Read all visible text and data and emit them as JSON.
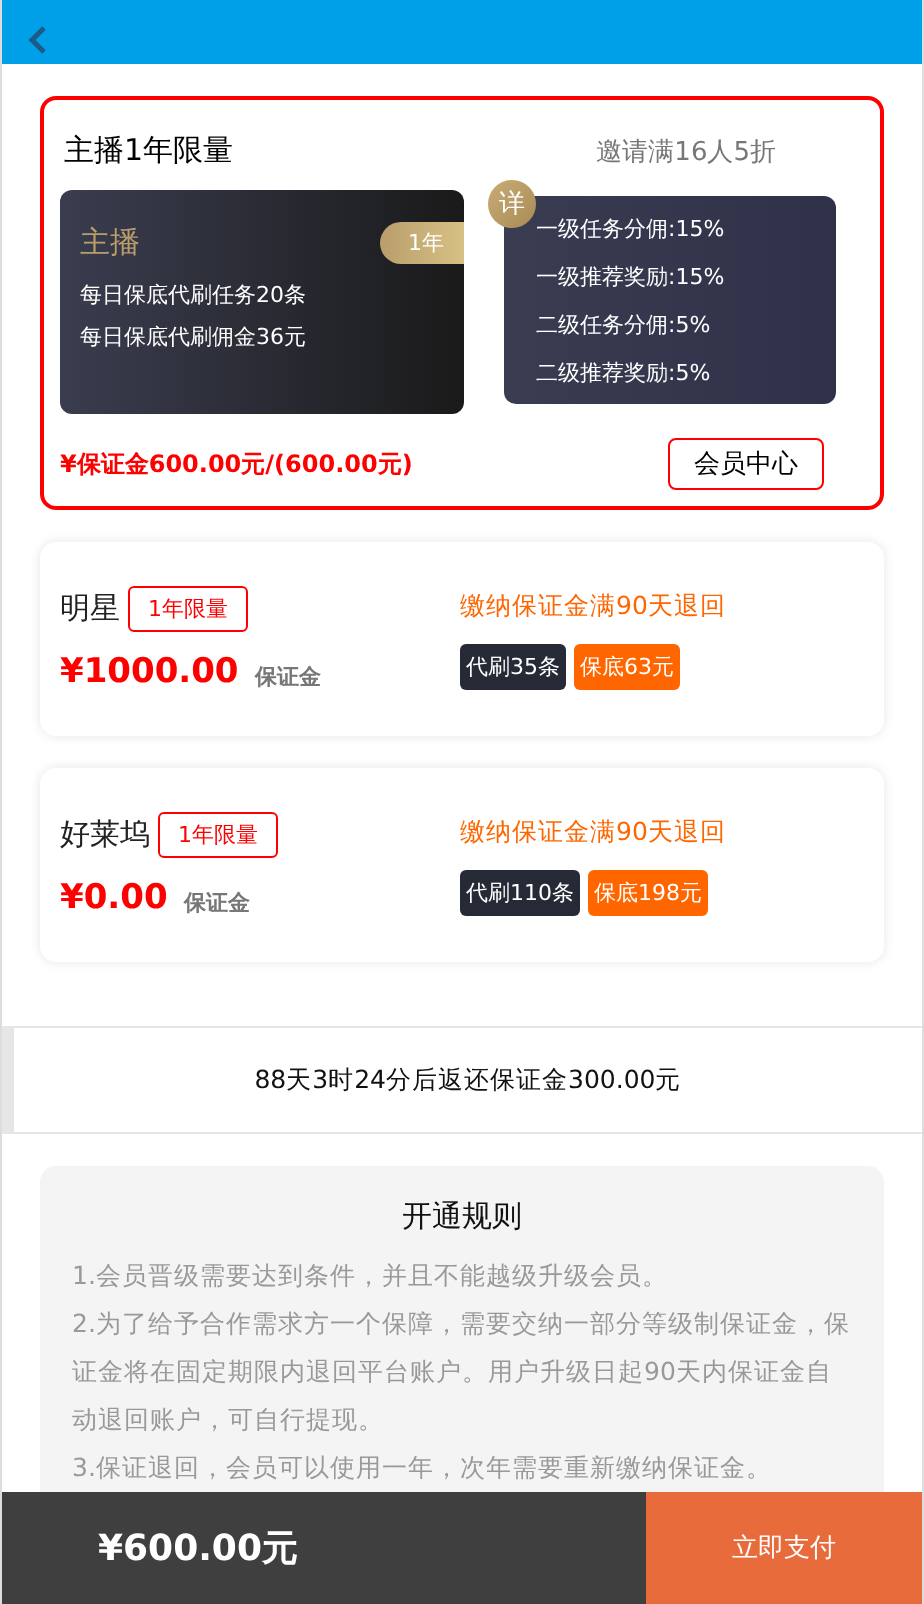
{
  "plans": [
    {
      "kind": "featured",
      "selected": true,
      "title": "主播1年限量",
      "invite": "邀请满16人5折",
      "tier_name": "主播",
      "duration": "1年",
      "lines": [
        "每日保底代刷任务20条",
        "每日保底代刷佣金36元"
      ],
      "detail_badge": "详",
      "perks": [
        "一级任务分佣:15%",
        "一级推荐奖励:15%",
        "二级任务分佣:5%",
        "二级推荐奖励:5%"
      ],
      "deposit": "¥保证金600.00元/(600.00元)",
      "button": "会员中心"
    },
    {
      "kind": "compact",
      "selected": false,
      "title": "明星",
      "tag": "1年限量",
      "price": "¥1000.00",
      "price_label": "保证金",
      "refund_note": "缴纳保证金满90天退回",
      "chips": [
        {
          "text": "代刷35条",
          "color": "#262a36"
        },
        {
          "text": "保底63元",
          "color": "#ff6600"
        }
      ]
    },
    {
      "kind": "compact",
      "selected": false,
      "title": "好莱坞",
      "tag": "1年限量",
      "price": "¥0.00",
      "price_label": "保证金",
      "refund_note": "缴纳保证金满90天退回",
      "chips": [
        {
          "text": "代刷110条",
          "color": "#262a36"
        },
        {
          "text": "保底198元",
          "color": "#ff6600"
        }
      ]
    }
  ],
  "countdown": "88天3时24分后返还保证金300.00元",
  "rules": {
    "title": "开通规则",
    "items": [
      "1.会员晋级需要达到条件，并且不能越级升级会员。",
      "2.为了给予合作需求方一个保障，需要交纳一部分等级制保证金，保证金将在固定期限内退回平台账户。用户升级日起90天内保证金自动退回账户，可自行提现。",
      "3.保证退回，会员可以使用一年，次年需要重新缴纳保证金。"
    ]
  },
  "footer": {
    "total": "¥600.00元",
    "pay_button": "立即支付"
  }
}
